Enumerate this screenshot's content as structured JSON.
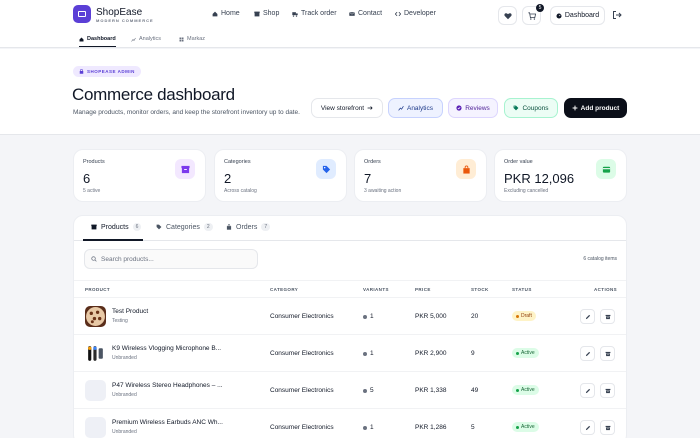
{
  "brand": {
    "name": "ShopEase",
    "tagline": "MODERN COMMERCE"
  },
  "topnav": [
    {
      "label": "Home",
      "icon": "home-icon"
    },
    {
      "label": "Shop",
      "icon": "store-icon"
    },
    {
      "label": "Track order",
      "icon": "truck-icon"
    },
    {
      "label": "Contact",
      "icon": "mail-icon"
    },
    {
      "label": "Developer",
      "icon": "code-icon"
    }
  ],
  "header_actions": {
    "cart_count": "5",
    "dashboard_label": "Dashboard"
  },
  "subnav": [
    {
      "label": "Dashboard",
      "active": true
    },
    {
      "label": "Analytics",
      "active": false
    },
    {
      "label": "Markaz",
      "active": false
    }
  ],
  "hero": {
    "badge": "SHOPEASE ADMIN",
    "title": "Commerce dashboard",
    "subtitle": "Manage products, monitor orders, and keep the storefront inventory up to date.",
    "buttons": {
      "view_storefront": "View storefront",
      "analytics": "Analytics",
      "reviews": "Reviews",
      "coupons": "Coupons",
      "add_product": "Add product"
    }
  },
  "stats": [
    {
      "label": "Products",
      "value": "6",
      "sub": "5 active",
      "icon": "box-icon",
      "color": "#7c3aed"
    },
    {
      "label": "Categories",
      "value": "2",
      "sub": "Across catalog",
      "icon": "tag-icon",
      "color": "#2563eb"
    },
    {
      "label": "Orders",
      "value": "7",
      "sub": "3 awaiting action",
      "icon": "bag-icon",
      "color": "#ea580c"
    },
    {
      "label": "Order value",
      "value": "PKR 12,096",
      "sub": "Excluding cancelled",
      "icon": "wallet-icon",
      "color": "#16a34a"
    }
  ],
  "panel": {
    "tabs": [
      {
        "label": "Products",
        "count": "6"
      },
      {
        "label": "Categories",
        "count": "2"
      },
      {
        "label": "Orders",
        "count": "7"
      }
    ],
    "search_placeholder": "Search products...",
    "catalog_count": "6 catalog items",
    "columns": {
      "product": "PRODUCT",
      "category": "CATEGORY",
      "variants": "VARIANTS",
      "price": "PRICE",
      "stock": "STOCK",
      "status": "STATUS",
      "actions": "ACTIONS"
    },
    "rows": [
      {
        "name": "Test Product",
        "brand": "Testing",
        "category": "Consumer Electronics",
        "variants": "1",
        "price": "PKR 5,000",
        "stock": "20",
        "status": "Draft"
      },
      {
        "name": "K9 Wireless Vlogging Microphone B...",
        "brand": "Unbranded",
        "category": "Consumer Electronics",
        "variants": "1",
        "price": "PKR 2,900",
        "stock": "9",
        "status": "Active"
      },
      {
        "name": "P47 Wireless Stereo Headphones – ...",
        "brand": "Unbranded",
        "category": "Consumer Electronics",
        "variants": "5",
        "price": "PKR 1,338",
        "stock": "49",
        "status": "Active"
      },
      {
        "name": "Premium Wireless Earbuds ANC Wh...",
        "brand": "Unbranded",
        "category": "Consumer Electronics",
        "variants": "1",
        "price": "PKR 1,286",
        "stock": "5",
        "status": "Active"
      }
    ]
  },
  "colors": {
    "brand": "#5b3fd6",
    "draft": "#d97706",
    "active": "#16a34a"
  }
}
